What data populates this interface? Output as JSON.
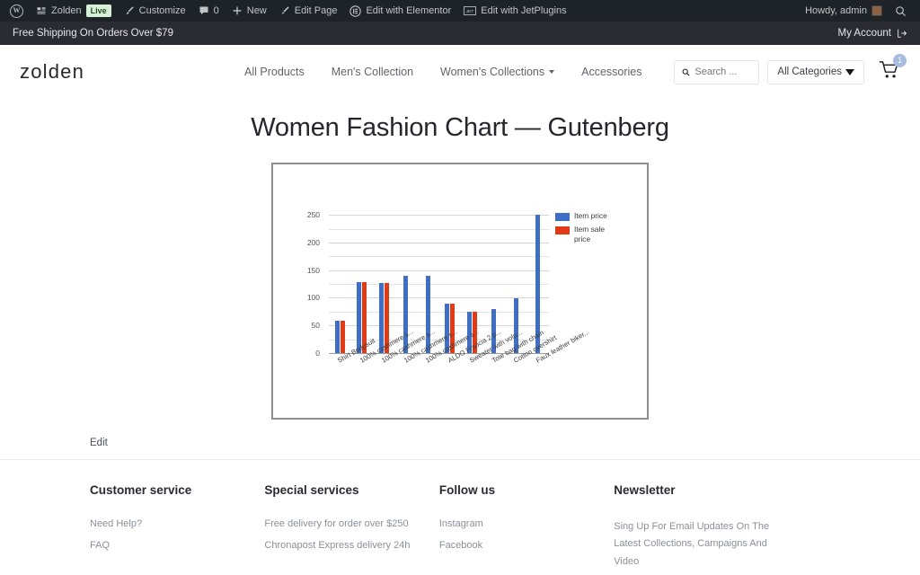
{
  "adminbar": {
    "logo_icon": "wordpress-logo-icon",
    "items": [
      {
        "label": "Zolden",
        "icon": "site-dashboard-icon",
        "badge": "Live"
      },
      {
        "label": "Customize",
        "icon": "paintbrush-icon"
      },
      {
        "label": "0",
        "icon": "comment-bubble-icon"
      },
      {
        "label": "New",
        "icon": "plus-icon"
      },
      {
        "label": "Edit Page",
        "icon": "pencil-icon"
      },
      {
        "label": "Edit with Elementor",
        "icon": "elementor-icon"
      },
      {
        "label": "Edit with JetPlugins",
        "icon": "jetplugins-icon"
      }
    ],
    "howdy": "Howdy, admin",
    "avatar_icon": "user-avatar",
    "search_icon": "search-icon"
  },
  "shipping": {
    "message": "Free Shipping On Orders Over $79",
    "account_label": "My Account",
    "logout_icon": "logout-icon"
  },
  "header": {
    "brand": "zolden",
    "nav": [
      {
        "label": "All Products",
        "has_caret": false
      },
      {
        "label": "Men's Collection",
        "has_caret": false
      },
      {
        "label": "Women's Collections",
        "has_caret": true
      },
      {
        "label": "Accessories",
        "has_caret": false
      }
    ],
    "search_placeholder": "Search ...",
    "search_value": "",
    "search_icon": "search-icon",
    "categories_label": "All Categories",
    "cart_icon": "shopping-cart-icon",
    "cart_count": "1"
  },
  "page": {
    "title": "Women Fashion Chart — Gutenberg",
    "edit_label": "Edit"
  },
  "chart_data": {
    "type": "bar",
    "title": "",
    "xlabel": "",
    "ylabel": "",
    "ylim": [
      0,
      260
    ],
    "yticks": [
      0,
      50,
      100,
      150,
      200,
      250
    ],
    "minor_gridlines": true,
    "legend_position": "right",
    "colors": {
      "item_price": "#3f6fc4",
      "item_sale_price": "#e03a17"
    },
    "categories": [
      "Shirt Bodysuit",
      "100% cashmere s...",
      "100% cashmere s...",
      "100% cashmere s...",
      "100% cashmere s...",
      "ALDO Fraocia 2 p...",
      "Sweater with volu...",
      "Tote bag with chain",
      "Cotton overshirt",
      "Faux leather biker..."
    ],
    "series": [
      {
        "name": "Item price",
        "values": [
          59,
          129,
          127,
          139,
          139,
          90,
          75,
          80,
          99,
          250
        ]
      },
      {
        "name": "Item sale price",
        "values": [
          59,
          129,
          127,
          null,
          null,
          90,
          75,
          null,
          null,
          null
        ]
      }
    ]
  },
  "footer": {
    "columns": [
      {
        "title": "Customer service",
        "links": [
          "Need Help?",
          "FAQ"
        ],
        "text": ""
      },
      {
        "title": "Special services",
        "links": [
          "Free delivery for order over $250",
          "Chronapost Express delivery 24h"
        ],
        "text": ""
      },
      {
        "title": "Follow us",
        "links": [
          "Instagram",
          "Facebook"
        ],
        "text": ""
      },
      {
        "title": "Newsletter",
        "links": [],
        "text": "Sing Up For Email Updates On The Latest Collections, Campaigns And Video"
      }
    ]
  }
}
